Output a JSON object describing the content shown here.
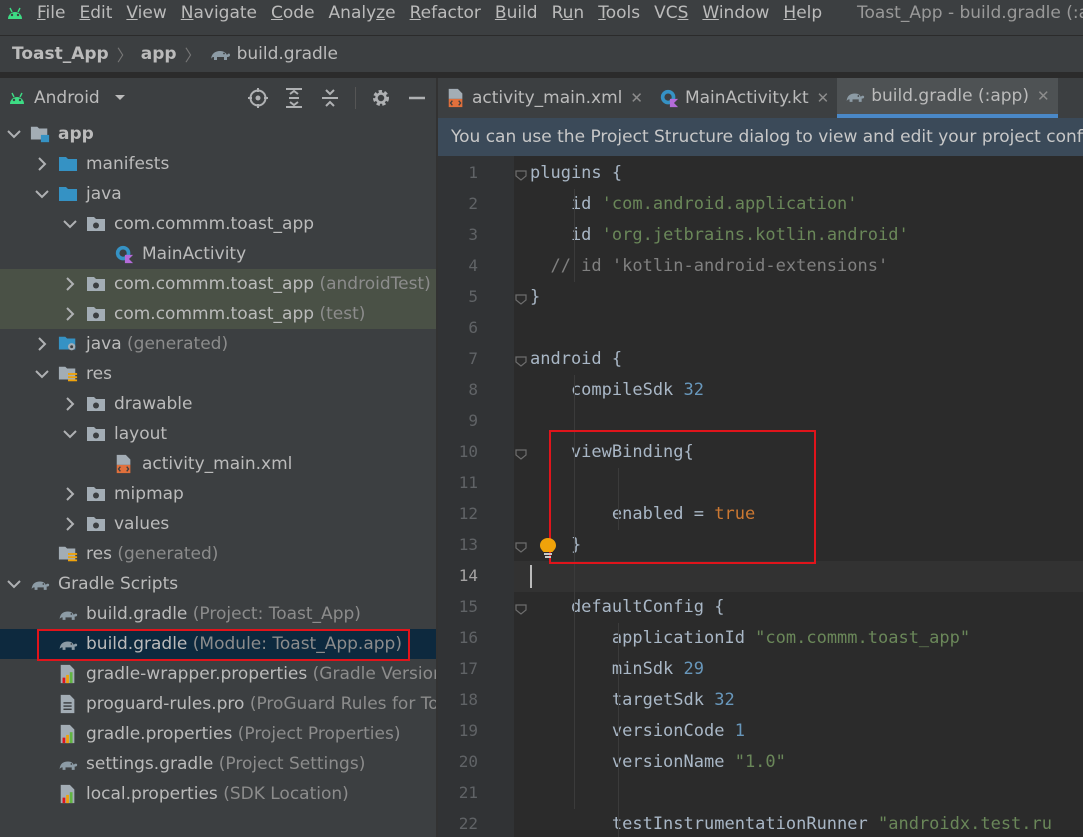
{
  "menubar": {
    "items": [
      "File",
      "Edit",
      "View",
      "Navigate",
      "Code",
      "Analyze",
      "Refactor",
      "Build",
      "Run",
      "Tools",
      "VCS",
      "Window",
      "Help"
    ],
    "mnemonics": [
      "F",
      "E",
      "V",
      "N",
      "C",
      "z",
      "R",
      "B",
      "u",
      "T",
      "S",
      "W",
      "H"
    ],
    "window_title": "Toast_App - build.gradle (:ap"
  },
  "breadcrumb": {
    "items": [
      "Toast_App",
      "app",
      "build.gradle"
    ]
  },
  "project_panel": {
    "view_mode": "Android",
    "tree": [
      {
        "label": "app",
        "suffix": "",
        "depth": 0,
        "expanded": true,
        "icon": "module-folder-icon",
        "bold": true
      },
      {
        "label": "manifests",
        "suffix": "",
        "depth": 1,
        "expanded": false,
        "icon": "folder-icon"
      },
      {
        "label": "java",
        "suffix": "",
        "depth": 1,
        "expanded": true,
        "icon": "folder-icon"
      },
      {
        "label": "com.commm.toast_app",
        "suffix": "",
        "depth": 2,
        "expanded": true,
        "icon": "package-icon"
      },
      {
        "label": "MainActivity",
        "suffix": "",
        "depth": 3,
        "expanded": null,
        "icon": "kotlin-class-icon"
      },
      {
        "label": "com.commm.toast_app",
        "suffix": "(androidTest)",
        "depth": 2,
        "expanded": false,
        "icon": "package-icon",
        "highlight": "test"
      },
      {
        "label": "com.commm.toast_app",
        "suffix": "(test)",
        "depth": 2,
        "expanded": false,
        "icon": "package-icon",
        "highlight": "test"
      },
      {
        "label": "java",
        "suffix": "(generated)",
        "depth": 1,
        "expanded": false,
        "icon": "generated-folder-icon"
      },
      {
        "label": "res",
        "suffix": "",
        "depth": 1,
        "expanded": true,
        "icon": "res-folder-icon"
      },
      {
        "label": "drawable",
        "suffix": "",
        "depth": 2,
        "expanded": false,
        "icon": "package-icon"
      },
      {
        "label": "layout",
        "suffix": "",
        "depth": 2,
        "expanded": true,
        "icon": "package-icon"
      },
      {
        "label": "activity_main.xml",
        "suffix": "",
        "depth": 3,
        "expanded": null,
        "icon": "xml-file-icon"
      },
      {
        "label": "mipmap",
        "suffix": "",
        "depth": 2,
        "expanded": false,
        "icon": "package-icon"
      },
      {
        "label": "values",
        "suffix": "",
        "depth": 2,
        "expanded": false,
        "icon": "package-icon"
      },
      {
        "label": "res",
        "suffix": "(generated)",
        "depth": 1,
        "expanded": null,
        "icon": "res-folder-icon"
      },
      {
        "label": "Gradle Scripts",
        "suffix": "",
        "depth": 0,
        "expanded": true,
        "icon": "gradle-icon"
      },
      {
        "label": "build.gradle",
        "suffix": "(Project: Toast_App)",
        "depth": 1,
        "expanded": null,
        "icon": "gradle-icon"
      },
      {
        "label": "build.gradle",
        "suffix": "(Module: Toast_App.app)",
        "depth": 1,
        "expanded": null,
        "icon": "gradle-icon",
        "selected": true
      },
      {
        "label": "gradle-wrapper.properties",
        "suffix": "(Gradle Version",
        "depth": 1,
        "expanded": null,
        "icon": "properties-file-icon"
      },
      {
        "label": "proguard-rules.pro",
        "suffix": "(ProGuard Rules for To",
        "depth": 1,
        "expanded": null,
        "icon": "text-file-icon"
      },
      {
        "label": "gradle.properties",
        "suffix": "(Project Properties)",
        "depth": 1,
        "expanded": null,
        "icon": "properties-file-icon"
      },
      {
        "label": "settings.gradle",
        "suffix": "(Project Settings)",
        "depth": 1,
        "expanded": null,
        "icon": "gradle-icon"
      },
      {
        "label": "local.properties",
        "suffix": "(SDK Location)",
        "depth": 1,
        "expanded": null,
        "icon": "properties-file-icon"
      }
    ]
  },
  "tabs": [
    {
      "label": "activity_main.xml",
      "icon": "xml-file-icon",
      "active": false
    },
    {
      "label": "MainActivity.kt",
      "icon": "kotlin-class-icon",
      "active": false
    },
    {
      "label": "build.gradle (:app)",
      "icon": "gradle-icon",
      "active": true
    }
  ],
  "banner": {
    "text": "You can use the Project Structure dialog to view and edit your project configu"
  },
  "editor": {
    "current_line": 14,
    "lines": [
      [
        {
          "t": "plugins {",
          "c": ""
        }
      ],
      [
        {
          "t": "    id ",
          "c": ""
        },
        {
          "t": "'com.android.application'",
          "c": "str"
        }
      ],
      [
        {
          "t": "    id ",
          "c": ""
        },
        {
          "t": "'org.jetbrains.kotlin.android'",
          "c": "str"
        }
      ],
      [
        {
          "t": "  // id 'kotlin-android-extensions'",
          "c": "cmt"
        }
      ],
      [
        {
          "t": "}",
          "c": ""
        }
      ],
      [
        {
          "t": "",
          "c": ""
        }
      ],
      [
        {
          "t": "android {",
          "c": ""
        }
      ],
      [
        {
          "t": "    compileSdk ",
          "c": ""
        },
        {
          "t": "32",
          "c": "num"
        }
      ],
      [
        {
          "t": "",
          "c": ""
        }
      ],
      [
        {
          "t": "    viewBinding{",
          "c": ""
        }
      ],
      [
        {
          "t": "",
          "c": ""
        }
      ],
      [
        {
          "t": "        enabled = ",
          "c": ""
        },
        {
          "t": "true",
          "c": "kw"
        }
      ],
      [
        {
          "t": "    }",
          "c": ""
        }
      ],
      [
        {
          "t": "",
          "c": ""
        }
      ],
      [
        {
          "t": "    defaultConfig {",
          "c": ""
        }
      ],
      [
        {
          "t": "        applicationId ",
          "c": ""
        },
        {
          "t": "\"com.commm.toast_app\"",
          "c": "str"
        }
      ],
      [
        {
          "t": "        minSdk ",
          "c": ""
        },
        {
          "t": "29",
          "c": "num"
        }
      ],
      [
        {
          "t": "        targetSdk ",
          "c": ""
        },
        {
          "t": "32",
          "c": "num"
        }
      ],
      [
        {
          "t": "        versionCode ",
          "c": ""
        },
        {
          "t": "1",
          "c": "num"
        }
      ],
      [
        {
          "t": "        versionName ",
          "c": ""
        },
        {
          "t": "\"1.0\"",
          "c": "str"
        }
      ],
      [
        {
          "t": "",
          "c": ""
        }
      ],
      [
        {
          "t": "        testInstrumentationRunner ",
          "c": ""
        },
        {
          "t": "\"androidx.test.ru",
          "c": "str"
        }
      ]
    ]
  },
  "colors": {
    "panel_bg": "#3c3f41",
    "editor_bg": "#2b2b2b",
    "annotation_red": "#e0141b",
    "selection_bg": "#0d293e",
    "accent_blue": "#4a88c7"
  }
}
